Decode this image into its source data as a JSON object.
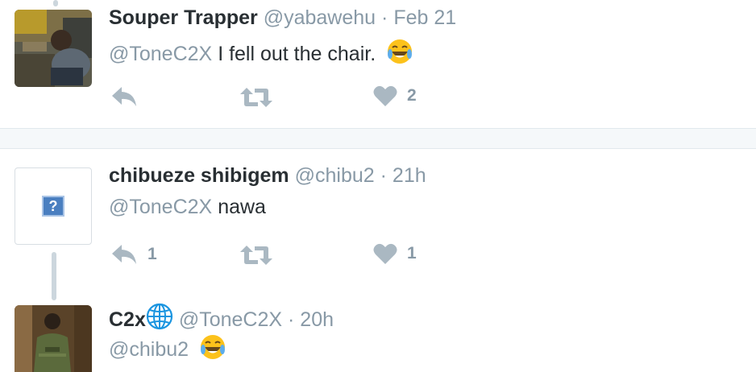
{
  "tweets": [
    {
      "display_name": "Souper Trapper",
      "handle": "@yabawehu",
      "separator": "·",
      "time": "Feb 21",
      "mention": "@ToneC2X",
      "text": "I fell out the chair.",
      "emoji": "face-with-tears-of-joy",
      "reply_count": "",
      "retweet_count": "",
      "like_count": "2"
    },
    {
      "display_name": "chibueze shibigem",
      "handle": "@chibu2",
      "separator": "·",
      "time": "21h",
      "mention": "@ToneC2X",
      "text": "nawa",
      "reply_count": "1",
      "retweet_count": "",
      "like_count": "1"
    },
    {
      "display_name": "C2x",
      "handle": "@ToneC2X",
      "separator": "·",
      "time": "20h",
      "mention": "@chibu2",
      "text": "",
      "emoji": "face-with-tears-of-joy"
    }
  ],
  "icons": {
    "reply": "reply-icon",
    "retweet": "retweet-icon",
    "like": "heart-icon",
    "verified_globe": "globe-icon",
    "broken_avatar": "question-mark-icon"
  },
  "colors": {
    "text": "#292f33",
    "muted": "#8899a6",
    "icon": "#aab8c2",
    "thread_line": "#ccd6dd",
    "divider": "#f5f8fa",
    "globe": "#1b95e0"
  },
  "placeholder_glyph": "?"
}
